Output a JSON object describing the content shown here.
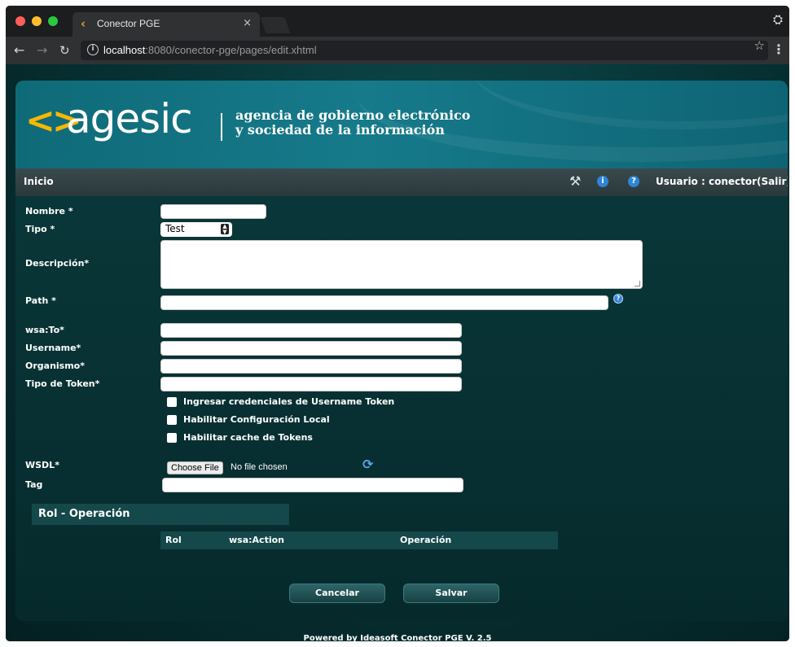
{
  "browser": {
    "tab_title": "Conector PGE",
    "tab_close": "×",
    "url_host": "localhost",
    "url_rest": ":8080/conector-pge/pages/edit.xhtml"
  },
  "banner": {
    "logo_brackets": "<>",
    "logo_word": "agesic",
    "tagline_line1": "agencia de gobierno electrónico",
    "tagline_line2": "y sociedad de la información"
  },
  "menubar": {
    "home": "Inicio",
    "user": "Usuario : conector",
    "logout": "(Salir)"
  },
  "form": {
    "nombre_label": "Nombre *",
    "tipo_label": "Tipo *",
    "tipo_value": "Test",
    "descripcion_label": "Descripción*",
    "path_label": "Path *",
    "wsato_label": "wsa:To*",
    "username_label": "Username*",
    "organismo_label": "Organismo*",
    "tipo_token_label": "Tipo de Token*",
    "chk_credenciales": "Ingresar credenciales de Username Token",
    "chk_config_local": "Habilitar Configuración Local",
    "chk_cache_tokens": "Habilitar cache de Tokens",
    "wsdl_label": "WSDL*",
    "file_button": "Choose File",
    "file_status": "No file chosen",
    "tag_label": "Tag"
  },
  "rol_section": {
    "title": "Rol - Operación",
    "columns": [
      "Rol",
      "wsa:Action",
      "Operación"
    ]
  },
  "actions": {
    "cancel": "Cancelar",
    "save": "Salvar"
  },
  "footer": "Powered by Ideasoft Conector PGE V. 2.5",
  "colors": {
    "accent_yellow": "#f5b800",
    "help_blue": "#2f86d8",
    "panel_teal": "#14484a"
  }
}
